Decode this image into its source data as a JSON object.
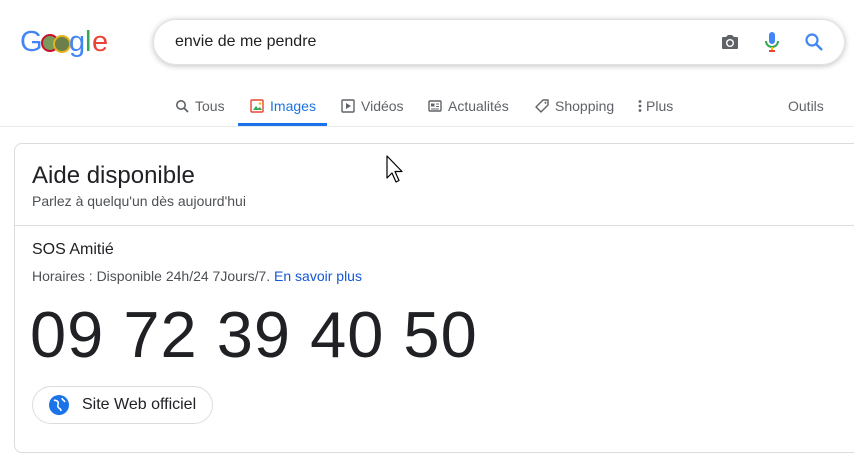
{
  "logo": {
    "text": "Google",
    "colors": [
      "#4285f4",
      "#ea4335",
      "#fbbc05",
      "#4285f4",
      "#34a853",
      "#ea4335"
    ]
  },
  "search": {
    "query": "envie de me pendre",
    "icons": [
      "camera-icon",
      "mic-icon",
      "search-icon"
    ]
  },
  "tabs": [
    {
      "label": "Tous",
      "icon": "search-icon"
    },
    {
      "label": "Images",
      "icon": "image-icon",
      "active": true
    },
    {
      "label": "Vidéos",
      "icon": "play-icon"
    },
    {
      "label": "Actualités",
      "icon": "news-icon"
    },
    {
      "label": "Shopping",
      "icon": "tag-icon"
    },
    {
      "label": "Plus",
      "icon": "more-vert-icon"
    }
  ],
  "tools_label": "Outils",
  "card": {
    "title": "Aide disponible",
    "subtitle": "Parlez à quelqu'un dès aujourd'hui",
    "org_name": "SOS Amitié",
    "hours_text": "Horaires : Disponible 24h/24 7Jours/7.",
    "more_link": "En savoir plus",
    "phone": "09 72 39 40 50",
    "site_button": "Site Web officiel"
  },
  "colors": {
    "accent": "#1a73e8",
    "link": "#1558d6",
    "text": "#202124",
    "muted": "#5f6368"
  }
}
